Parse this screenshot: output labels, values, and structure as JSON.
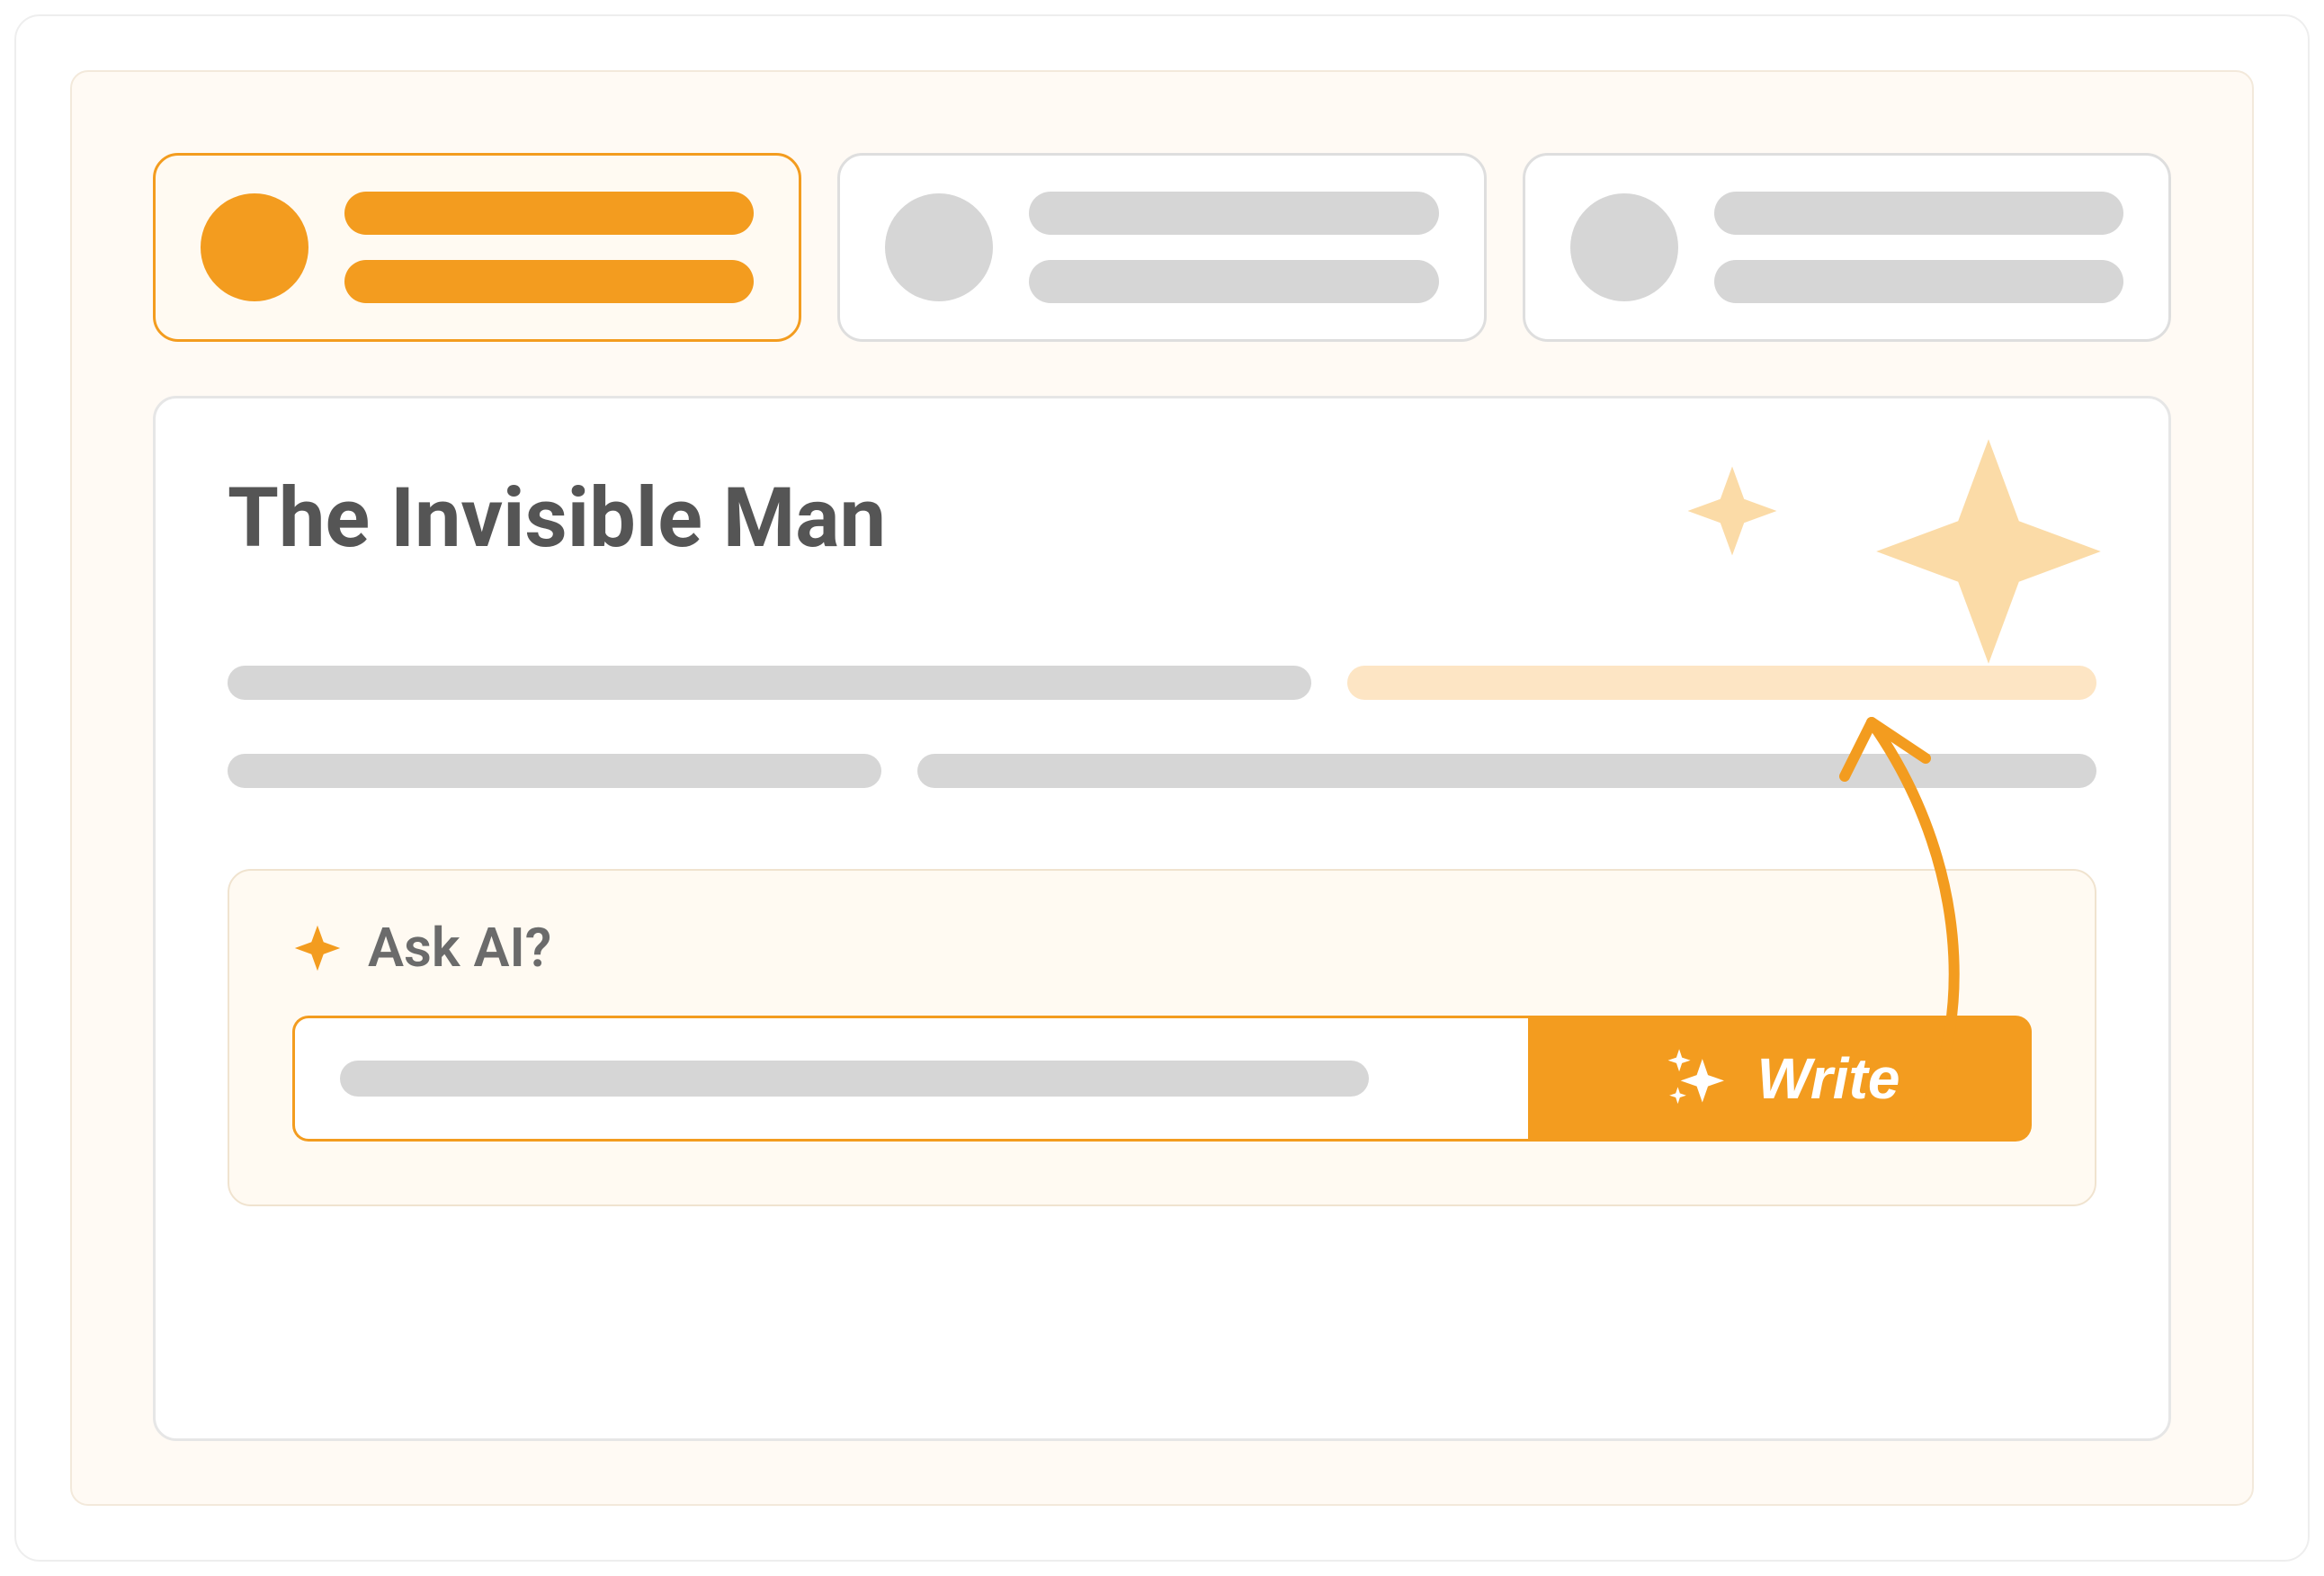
{
  "tabs": [
    {
      "active": true
    },
    {
      "active": false
    },
    {
      "active": false
    }
  ],
  "content": {
    "title": "The Invisible Man"
  },
  "ask": {
    "label": "Ask AI?",
    "button_label": "Write"
  },
  "colors": {
    "accent": "#f39c1f",
    "accent_light": "#fde5c4",
    "gray": "#d6d6d6",
    "text": "#555555"
  },
  "icons": {
    "sparkle_header": "sparkle-icon",
    "sparkle_button": "sparkles-icon",
    "star_small": "star-icon",
    "star_big": "star-icon"
  }
}
